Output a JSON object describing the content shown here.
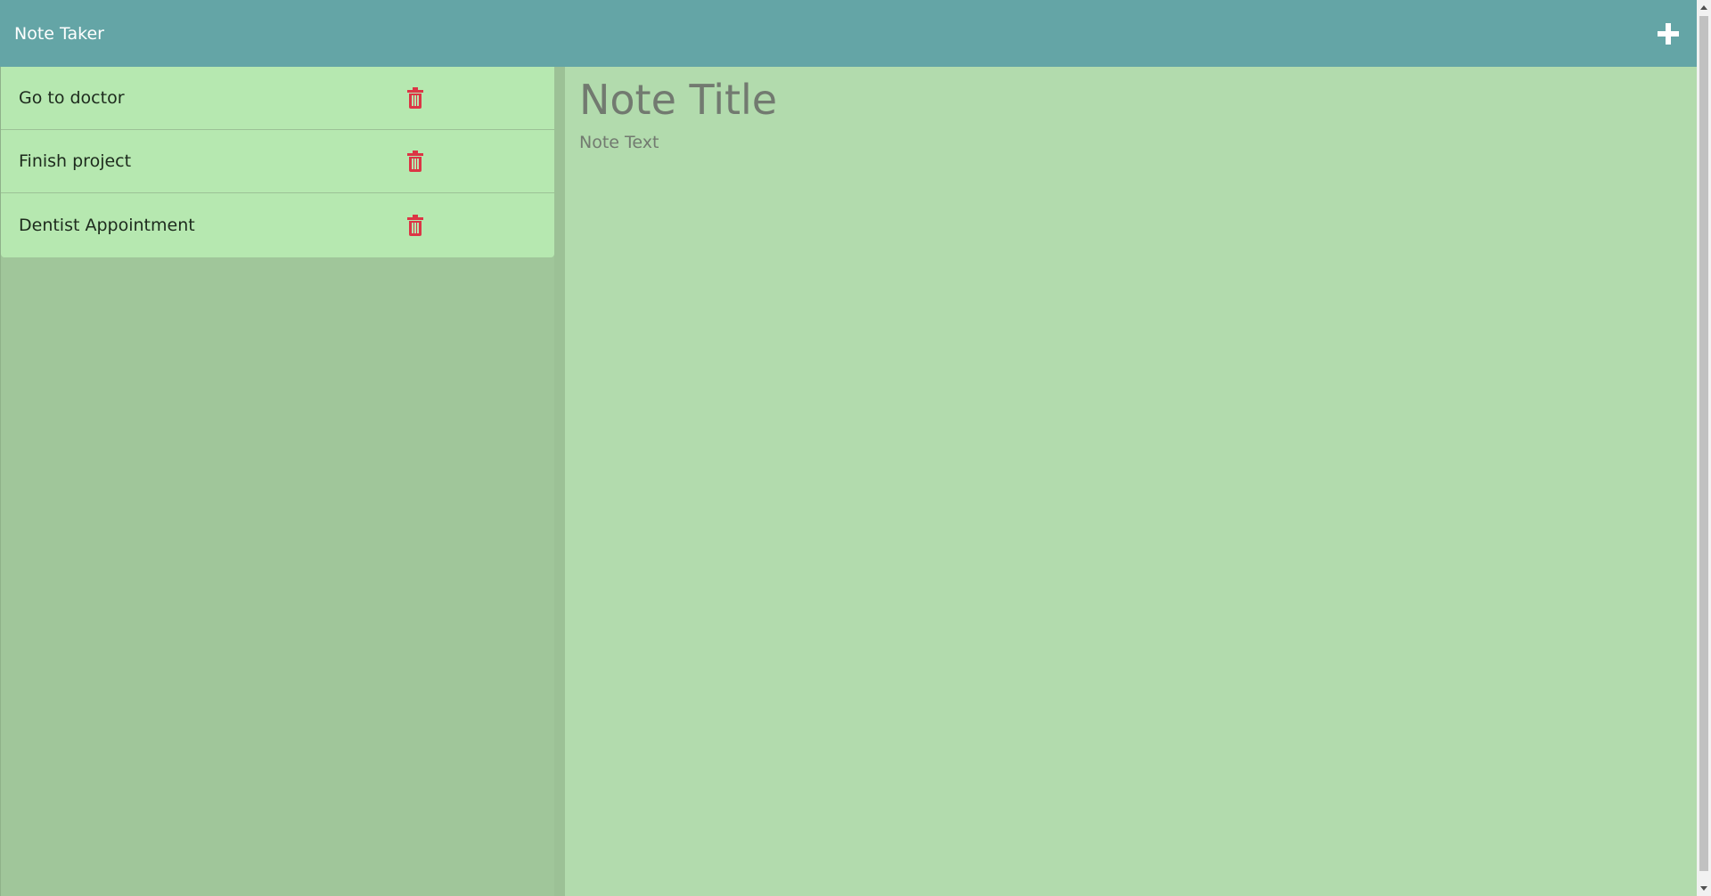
{
  "navbar": {
    "brand": "Note Taker",
    "add_icon": "plus-icon"
  },
  "sidebar": {
    "notes": [
      {
        "label": "Go to doctor",
        "delete_icon": "trash-icon"
      },
      {
        "label": "Finish project",
        "delete_icon": "trash-icon"
      },
      {
        "label": "Dentist Appointment",
        "delete_icon": "trash-icon"
      }
    ]
  },
  "editor": {
    "title_placeholder": "Note Title",
    "text_placeholder": "Note Text"
  },
  "colors": {
    "navbar": "#64a5a6",
    "note_item": "#b6e8b0",
    "sidebar": "#a0c69a",
    "editor": "#b2dbad",
    "trash": "#dc3545"
  }
}
